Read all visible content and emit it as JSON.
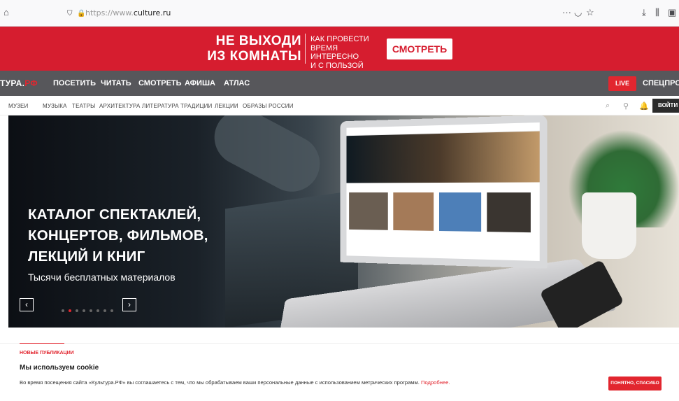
{
  "browser": {
    "url_prefix": "https://www.",
    "url_domain": "culture.ru",
    "icons": [
      "home-icon",
      "shield-icon",
      "lock-icon",
      "more-icon",
      "pocket-icon",
      "star-icon",
      "download-icon",
      "library-icon",
      "sidebar-icon"
    ],
    "more": "···"
  },
  "banner": {
    "headline_line1": "НЕ ВЫХОДИ",
    "headline_line2": "ИЗ КОМНАТЫ",
    "sub_line1": "КАК ПРОВЕСТИ",
    "sub_line2": "ВРЕМЯ ИНТЕРЕСНО",
    "sub_line3": "И С ПОЛЬЗОЙ",
    "button": "СМОТРЕТЬ",
    "bg": "#d61d2f"
  },
  "nav_main": {
    "logo_main": "ТУРА.",
    "logo_accent": "РФ",
    "items": [
      "ПОСЕТИТЬ",
      "ЧИТАТЬ",
      "СМОТРЕТЬ",
      "АФИША",
      "АТЛАС"
    ],
    "live": "LIVE",
    "special": "СПЕЦПРОЕКТ"
  },
  "nav_sub": {
    "items": [
      "МУЗЕИ",
      "МУЗЫКА",
      "ТЕАТРЫ",
      "АРХИТЕКТУРА",
      "ЛИТЕРАТУРА",
      "ТРАДИЦИИ",
      "ЛЕКЦИИ",
      "ОБРАЗЫ РОССИИ"
    ],
    "login": "ВОЙТИ"
  },
  "hero": {
    "title_line1": "КАТАЛОГ СПЕКТАКЛЕЙ,",
    "title_line2": "КОНЦЕРТОВ, ФИЛЬМОВ,",
    "title_line3": "ЛЕКЦИЙ И КНИГ",
    "subtitle": "Тысячи бесплатных материалов",
    "prev": "‹",
    "next": "›",
    "slides_total": 8,
    "active_slide": 2
  },
  "publications": {
    "label": "НОВЫЕ ПУБЛИКАЦИИ"
  },
  "cookie": {
    "title": "Мы используем cookie",
    "text": "Во время посещения сайта «Культура.РФ» вы соглашаетесь с тем, что мы обрабатываем ваши персональные данные с использованием метрических программ.",
    "link": "Подробнее.",
    "button": "ПОНЯТНО, СПАСИБО"
  }
}
